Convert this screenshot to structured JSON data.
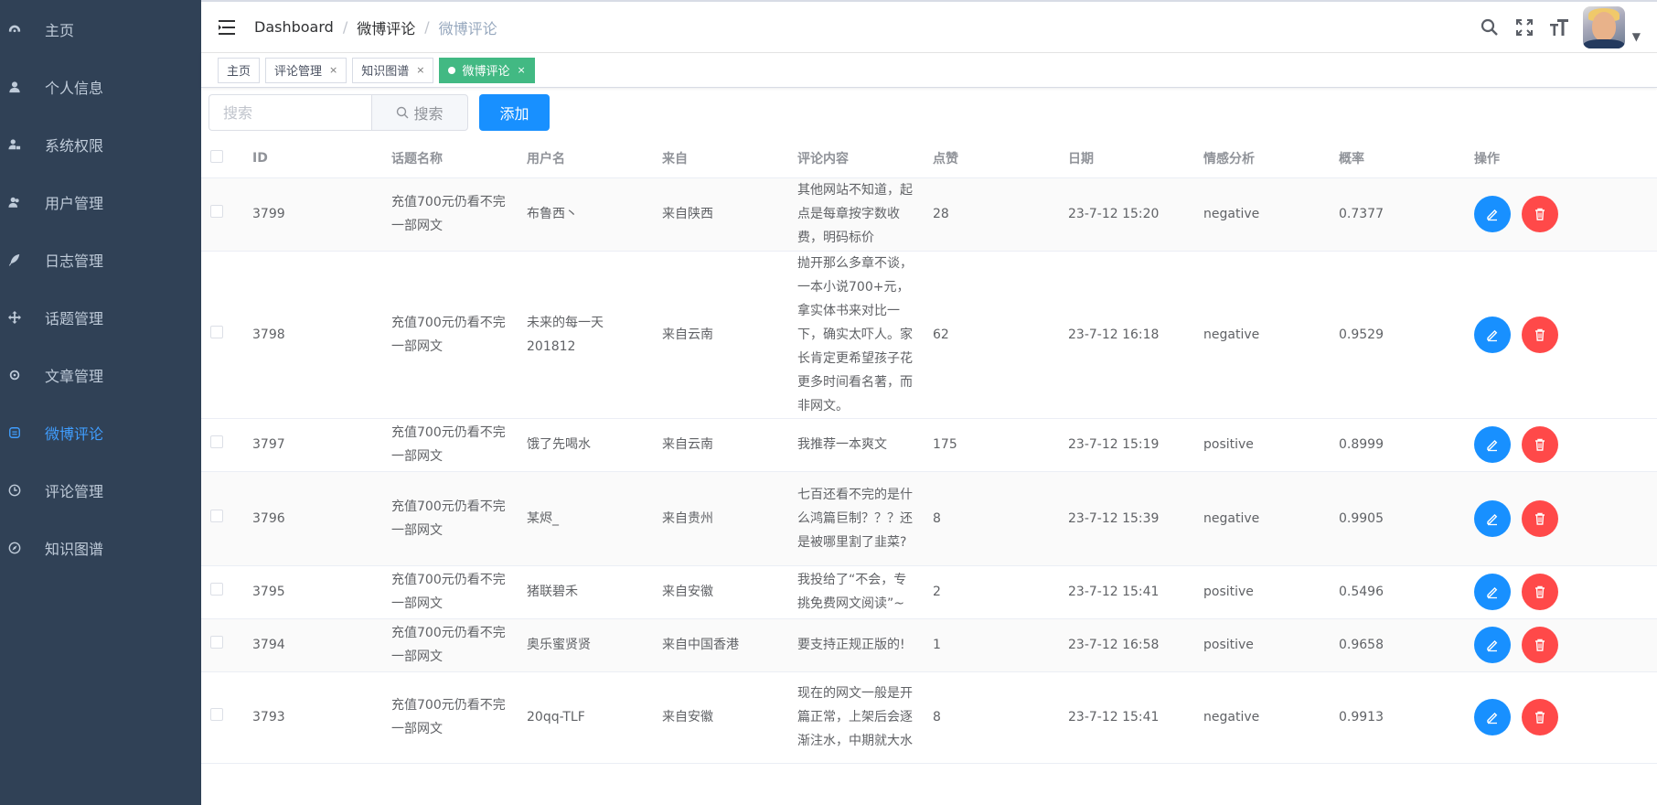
{
  "sidebar": {
    "items": [
      {
        "label": "主页",
        "icon": "dashboard-icon",
        "active": false
      },
      {
        "label": "个人信息",
        "icon": "user-icon",
        "active": false
      },
      {
        "label": "系统权限",
        "icon": "user-lock-icon",
        "active": false
      },
      {
        "label": "用户管理",
        "icon": "users-icon",
        "active": false
      },
      {
        "label": "日志管理",
        "icon": "feather-icon",
        "active": false
      },
      {
        "label": "话题管理",
        "icon": "arrows-move-icon",
        "active": false
      },
      {
        "label": "文章管理",
        "icon": "gear-icon",
        "active": false
      },
      {
        "label": "微博评论",
        "icon": "weibo-icon",
        "active": true
      },
      {
        "label": "评论管理",
        "icon": "clock-icon",
        "active": false
      },
      {
        "label": "知识图谱",
        "icon": "compass-icon",
        "active": false
      }
    ]
  },
  "header": {
    "breadcrumb": [
      "Dashboard",
      "微博评论",
      "微博评论"
    ]
  },
  "tags": [
    {
      "label": "主页",
      "active": false,
      "closable": false
    },
    {
      "label": "评论管理",
      "active": false,
      "closable": true
    },
    {
      "label": "知识图谱",
      "active": false,
      "closable": true
    },
    {
      "label": "微博评论",
      "active": true,
      "closable": true
    }
  ],
  "toolbar": {
    "search_placeholder": "搜索",
    "search_button": "搜索",
    "add_button": "添加"
  },
  "table": {
    "columns": [
      "ID",
      "话题名称",
      "用户名",
      "来自",
      "评论内容",
      "点赞",
      "日期",
      "情感分析",
      "概率",
      "操作"
    ],
    "rows": [
      {
        "id": "3799",
        "topic": "充值700元仍看不完一部网文",
        "user": "布鲁西丶",
        "from": "来自陕西",
        "content": "其他网站不知道，起点是每章按字数收费，明码标价",
        "likes": "28",
        "date": "23-7-12 15:20",
        "sentiment": "negative",
        "prob": "0.7377"
      },
      {
        "id": "3798",
        "topic": "充值700元仍看不完一部网文",
        "user": "未来的每一天201812",
        "from": "来自云南",
        "content": "抛开那么多章不谈，一本小说700+元，拿实体书来对比一下，确实太吓人。家长肯定更希望孩子花更多时间看名著，而非网文。",
        "likes": "62",
        "date": "23-7-12 16:18",
        "sentiment": "negative",
        "prob": "0.9529"
      },
      {
        "id": "3797",
        "topic": "充值700元仍看不完一部网文",
        "user": "饿了先喝水",
        "from": "来自云南",
        "content": "我推荐一本爽文",
        "likes": "175",
        "date": "23-7-12 15:19",
        "sentiment": "positive",
        "prob": "0.8999"
      },
      {
        "id": "3796",
        "topic": "充值700元仍看不完一部网文",
        "user": "某烬_",
        "from": "来自贵州",
        "content": "七百还看不完的是什么鸿篇巨制？？？还是被哪里割了韭菜?",
        "likes": "8",
        "date": "23-7-12 15:39",
        "sentiment": "negative",
        "prob": "0.9905"
      },
      {
        "id": "3795",
        "topic": "充值700元仍看不完一部网文",
        "user": "猪联碧禾",
        "from": "来自安徽",
        "content": "我投给了“不会，专挑免费网文阅读”~",
        "likes": "2",
        "date": "23-7-12 15:41",
        "sentiment": "positive",
        "prob": "0.5496"
      },
      {
        "id": "3794",
        "topic": "充值700元仍看不完一部网文",
        "user": "奥乐蜜贤贤",
        "from": "来自中国香港",
        "content": "要支持正规正版的!",
        "likes": "1",
        "date": "23-7-12 16:58",
        "sentiment": "positive",
        "prob": "0.9658"
      },
      {
        "id": "3793",
        "topic": "充值700元仍看不完一部网文",
        "user": "20qq-TLF",
        "from": "来自安徽",
        "content": "现在的网文一般是开篇正常，上架后会逐渐注水，中期就大水",
        "likes": "8",
        "date": "23-7-12 15:41",
        "sentiment": "negative",
        "prob": "0.9913"
      }
    ]
  }
}
